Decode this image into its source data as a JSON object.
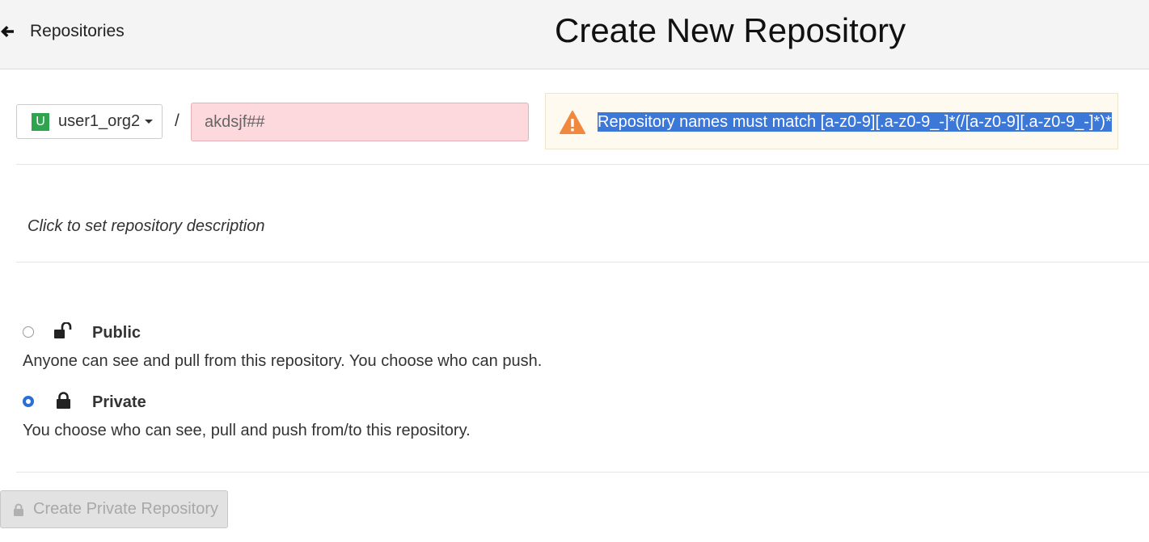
{
  "header": {
    "back_label": "Repositories",
    "title": "Create New Repository"
  },
  "namespace": {
    "avatar_letter": "U",
    "name": "user1_org2",
    "avatar_color": "#2ea44f"
  },
  "separator": "/",
  "repo_name": {
    "value": "akdsjf##"
  },
  "warning": {
    "icon": "warning-icon",
    "text": "Repository names must match [a-z0-9][.a-z0-9_-]*(/[a-z0-9][.a-z0-9_-]*)*",
    "icon_color": "#f0883e",
    "highlight_color": "#3b78d8"
  },
  "description": {
    "placeholder_text": "Click to set repository description"
  },
  "visibility": {
    "public": {
      "label": "Public",
      "description": "Anyone can see and pull from this repository. You choose who can push.",
      "icon": "unlock-icon",
      "selected": false
    },
    "private": {
      "label": "Private",
      "description": "You choose who can see, pull and push from/to this repository.",
      "icon": "lock-icon",
      "selected": true
    }
  },
  "create_button": {
    "label": "Create Private Repository",
    "icon": "lock-icon",
    "disabled": true
  },
  "colors": {
    "invalid_input_bg": "#fdd8dd",
    "radio_checked": "#2b6fd6"
  }
}
